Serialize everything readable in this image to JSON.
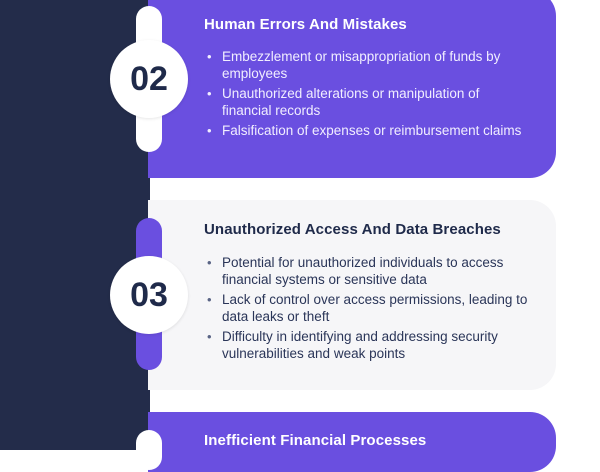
{
  "steps": [
    {
      "number": "02",
      "title": "Human Errors And Mistakes",
      "points": [
        "Embezzlement or misappropriation of funds by employees",
        "Unauthorized alterations or manipulation of financial records",
        "Falsification of expenses or reimbursement claims"
      ]
    },
    {
      "number": "03",
      "title": "Unauthorized Access And Data Breaches",
      "points": [
        "Potential for unauthorized individuals to access financial systems or sensitive data",
        "Lack of control over access permissions, leading to data leaks or theft",
        "Difficulty in identifying and addressing security vulnerabilities and weak points"
      ]
    },
    {
      "title": "Inefficient Financial Processes"
    }
  ],
  "colors": {
    "navy": "#232c4a",
    "purple": "#6a4fe0",
    "light_card": "#f6f6f8"
  }
}
